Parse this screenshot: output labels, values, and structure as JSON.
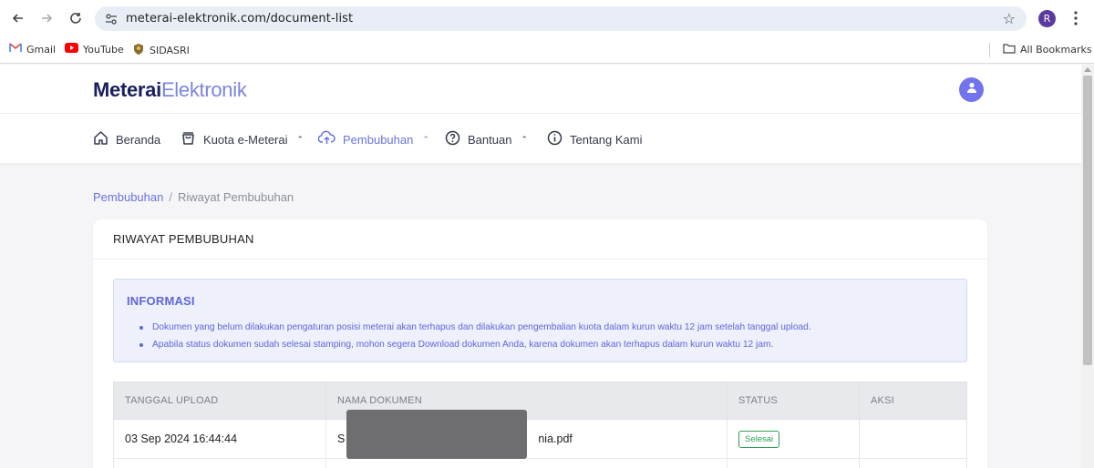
{
  "browser": {
    "url": "meterai-elektronik.com/document-list",
    "profile_initial": "R",
    "bookmarks": [
      {
        "label": "Gmail",
        "icon": "gmail-icon"
      },
      {
        "label": "YouTube",
        "icon": "youtube-icon"
      },
      {
        "label": "SIDASRI",
        "icon": "sidasri-icon"
      }
    ],
    "all_bookmarks": "All Bookmarks"
  },
  "site": {
    "logo_bold": "Meterai",
    "logo_light": "Elektronik",
    "menu": [
      {
        "label": "Beranda",
        "icon": "home-icon",
        "active": false
      },
      {
        "label": "Kuota e-Meterai",
        "icon": "bag-icon",
        "active": false,
        "dropdown": true
      },
      {
        "label": "Pembubuhan",
        "icon": "cloud-upload-icon",
        "active": true,
        "dropdown": true
      },
      {
        "label": "Bantuan",
        "icon": "help-icon",
        "active": false,
        "dropdown": true
      },
      {
        "label": "Tentang Kami",
        "icon": "info-icon",
        "active": false
      }
    ]
  },
  "breadcrumb": {
    "parent": "Pembubuhan",
    "separator": "/",
    "current": "Riwayat Pembubuhan"
  },
  "card": {
    "title": "RIWAYAT PEMBUBUHAN",
    "info": {
      "title": "INFORMASI",
      "items": [
        "Dokumen yang belum dilakukan pengaturan posisi meterai akan terhapus dan dilakukan pengembalian kuota dalam kurun waktu 12 jam setelah tanggal upload.",
        "Apabila status dokumen sudah selesai stamping, mohon segera Download dokumen Anda, karena dokumen akan terhapus dalam kurun waktu 12 jam."
      ]
    },
    "table": {
      "headers": [
        "TANGGAL UPLOAD",
        "NAMA DOKUMEN",
        "STATUS",
        "AKSI"
      ],
      "rows": [
        {
          "date": "03 Sep 2024 16:44:44",
          "name_prefix": "S",
          "name_suffix": "nia.pdf",
          "status": "Selesai"
        }
      ]
    }
  },
  "colors": {
    "accent": "#6a72e0",
    "logo_dark": "#1a1f5c",
    "status_done": "#2e9e52"
  }
}
